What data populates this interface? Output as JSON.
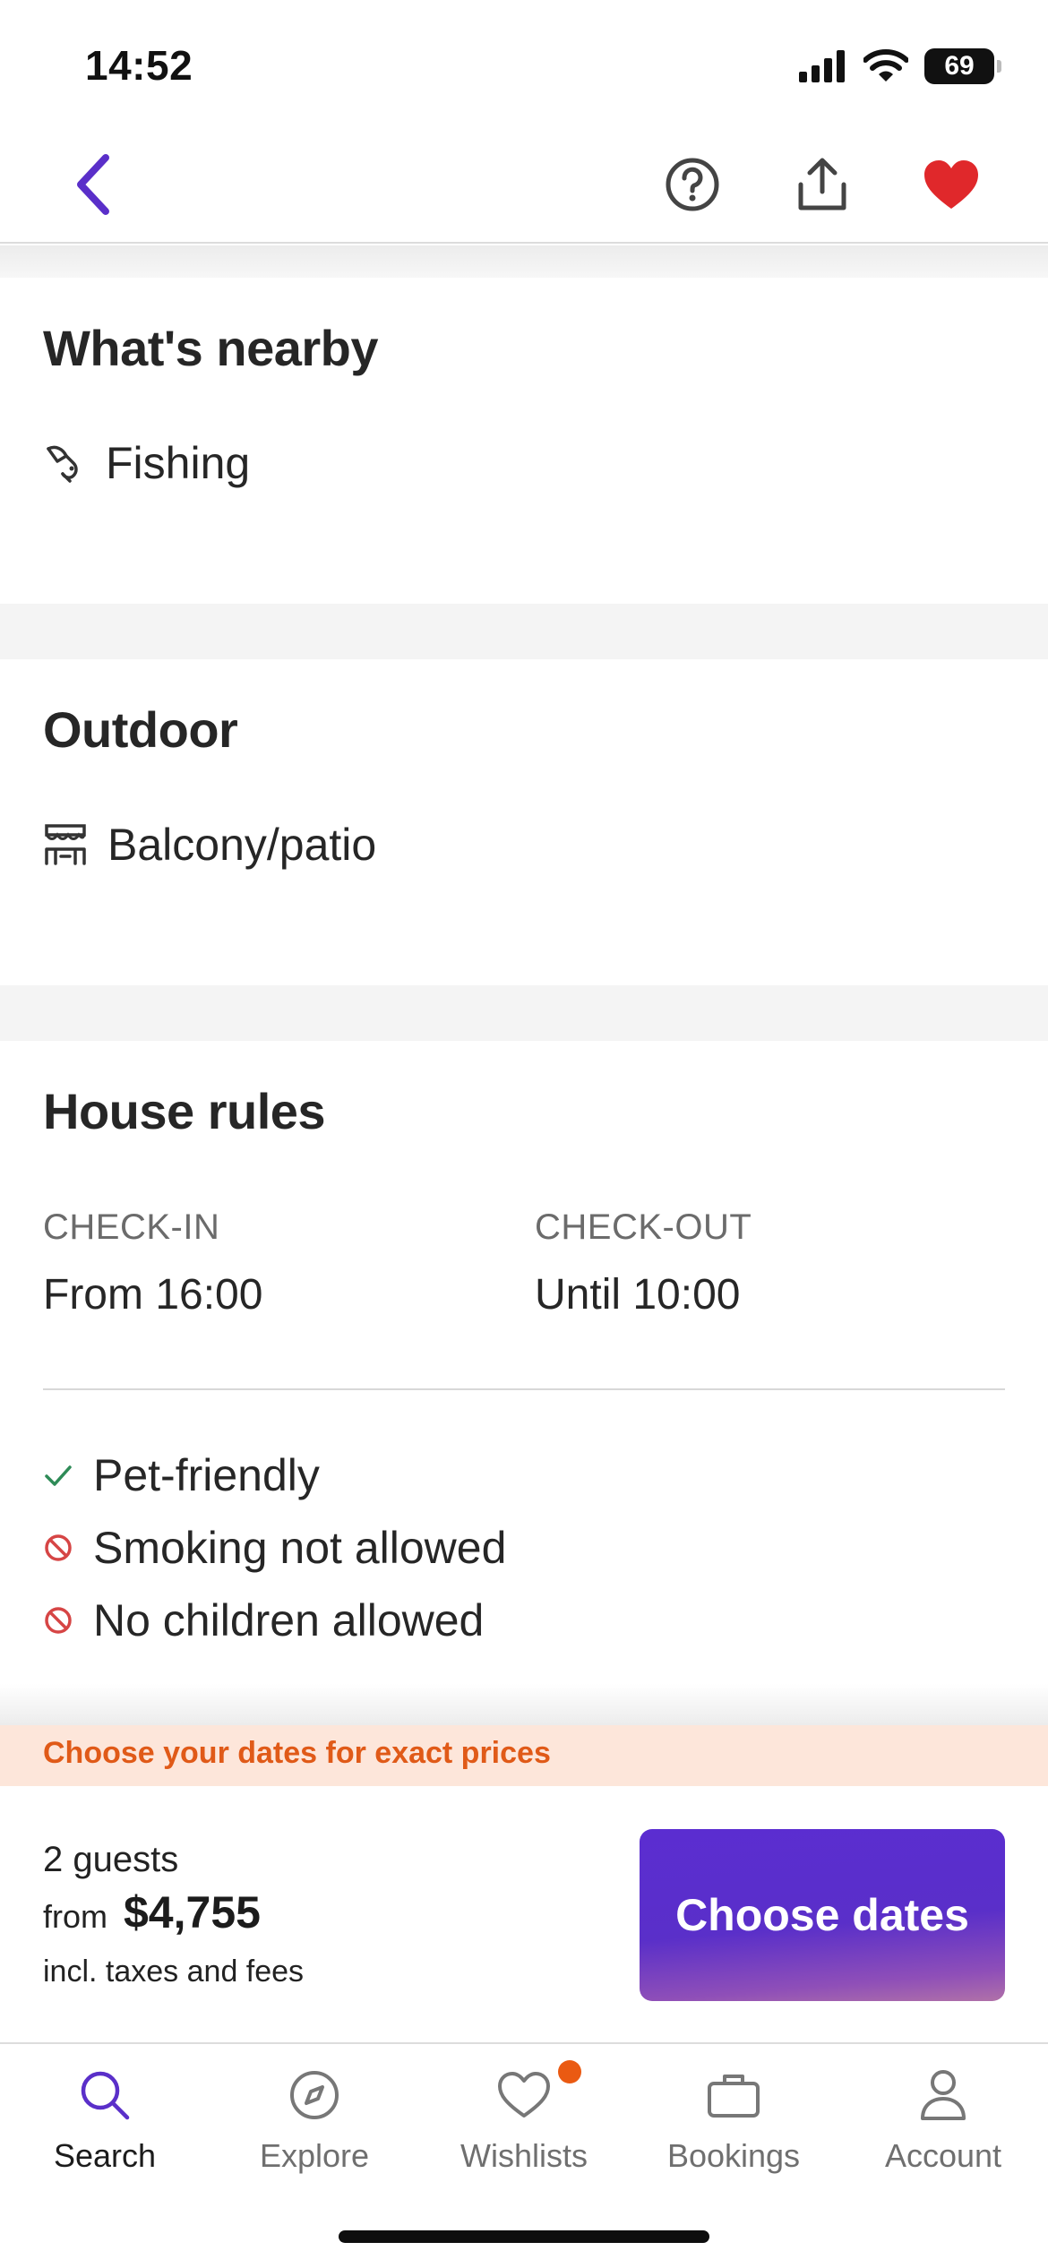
{
  "status_bar": {
    "time": "14:52",
    "battery": "69"
  },
  "colors": {
    "accent": "#5a2fc9",
    "heart": "#e0282b",
    "banner_text": "#e05a18",
    "banner_bg": "#fde6da",
    "badge": "#ea5a12"
  },
  "nav": {
    "icons": [
      "back-chevron-icon",
      "help-icon",
      "share-icon",
      "heart-icon"
    ]
  },
  "nearby": {
    "title": "What's nearby",
    "items": [
      {
        "icon": "fishing-icon",
        "label": "Fishing"
      }
    ]
  },
  "outdoor": {
    "title": "Outdoor",
    "items": [
      {
        "icon": "balcony-icon",
        "label": "Balcony/patio"
      }
    ]
  },
  "house_rules": {
    "title": "House rules",
    "checkin_label": "CHECK-IN",
    "checkin_value": "From 16:00",
    "checkout_label": "CHECK-OUT",
    "checkout_value": "Until 10:00",
    "rules": [
      {
        "icon": "check-icon",
        "label": "Pet-friendly"
      },
      {
        "icon": "prohibited-icon",
        "label": "Smoking not allowed"
      },
      {
        "icon": "prohibited-icon",
        "label": "No children allowed"
      }
    ]
  },
  "banner": {
    "text": "Choose your dates for exact prices"
  },
  "booking": {
    "guests": "2 guests",
    "from_label": "from",
    "price": "$4,755",
    "taxes": "incl. taxes and fees",
    "cta_label": "Choose dates"
  },
  "tabs": [
    {
      "label": "Search",
      "icon": "search-icon",
      "active": true
    },
    {
      "label": "Explore",
      "icon": "compass-icon"
    },
    {
      "label": "Wishlists",
      "icon": "heart-outline-icon",
      "badge": true
    },
    {
      "label": "Bookings",
      "icon": "briefcase-icon"
    },
    {
      "label": "Account",
      "icon": "person-icon"
    }
  ]
}
